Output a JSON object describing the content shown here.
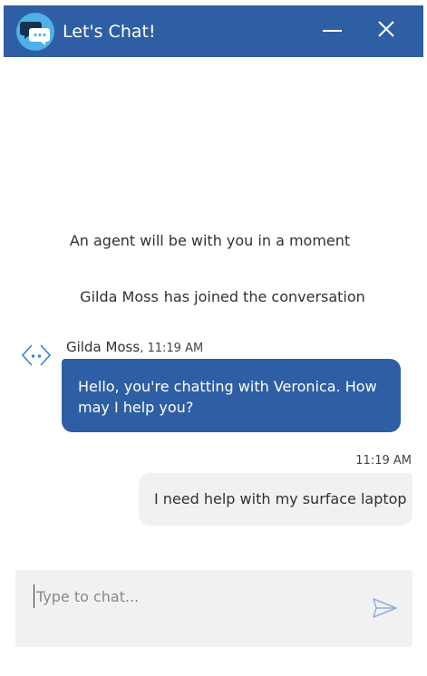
{
  "header": {
    "title": "Let's Chat!",
    "logo_icon": "chat-bubbles-icon",
    "minimize_icon": "minimize-icon",
    "close_icon": "close-icon",
    "color": "#2e5ea3"
  },
  "system": {
    "wait_message": "An agent will be with you in a moment",
    "joined_agent": "Gilda Moss",
    "joined_text": "has joined the conversation"
  },
  "messages": [
    {
      "sender": "Gilda Moss",
      "time": "11:19 AM",
      "text": "Hello, you're chatting with Veronica. How may I help you?",
      "from": "agent"
    },
    {
      "time": "11:19 AM",
      "text": "I need help with my surface laptop",
      "from": "user"
    }
  ],
  "composer": {
    "placeholder": "Type to chat...",
    "value": "",
    "send_icon": "send-icon"
  },
  "colors": {
    "agent_bubble": "#2e5ea3",
    "user_bubble": "#f1f1f3",
    "logo": "#4fb1e8"
  }
}
